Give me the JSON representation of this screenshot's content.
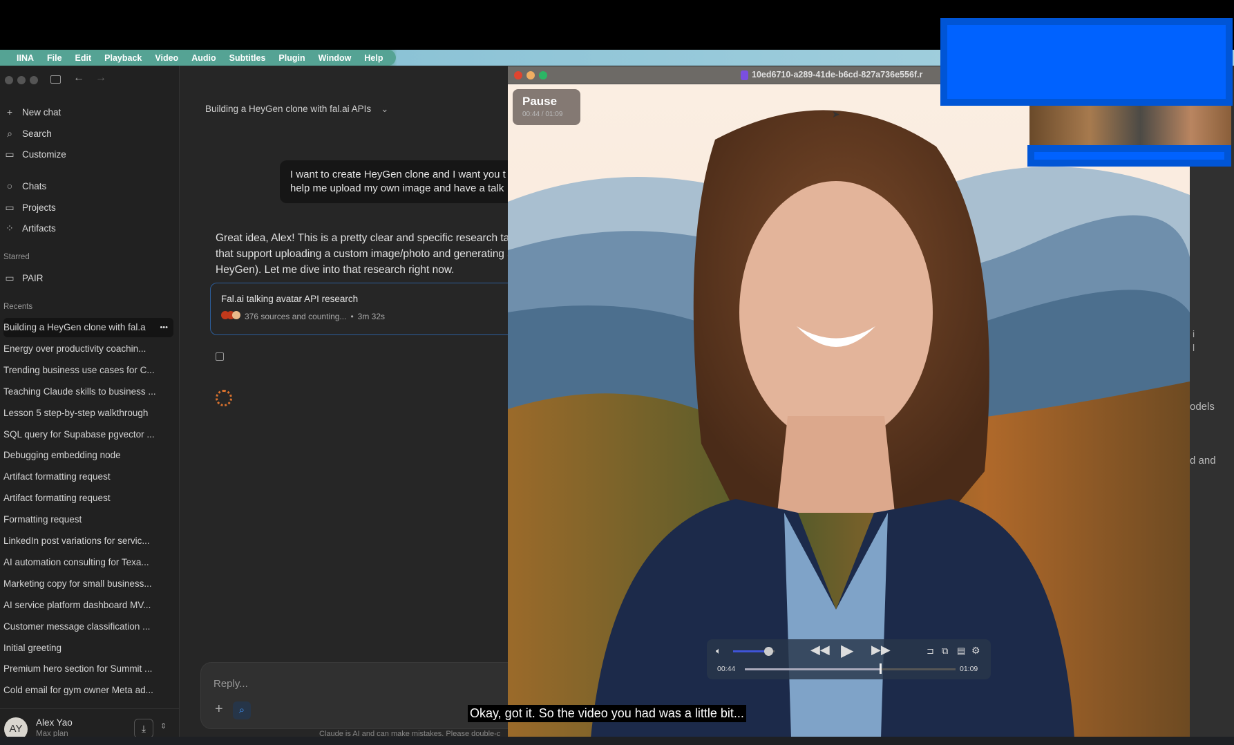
{
  "menubar": {
    "apple_icon": "apple-icon",
    "items": [
      "IINA",
      "File",
      "Edit",
      "Playback",
      "Video",
      "Audio",
      "Subtitles",
      "Plugin",
      "Window",
      "Help"
    ]
  },
  "sidebar": {
    "nav": [
      {
        "label": "New chat",
        "icon": "plus-icon"
      },
      {
        "label": "Search",
        "icon": "search-icon"
      },
      {
        "label": "Customize",
        "icon": "briefcase-icon"
      },
      {
        "label": "Chats",
        "icon": "chat-icon"
      },
      {
        "label": "Projects",
        "icon": "folder-icon"
      },
      {
        "label": "Artifacts",
        "icon": "artifacts-icon"
      }
    ],
    "starred_label": "Starred",
    "starred": [
      {
        "label": "PAIR"
      }
    ],
    "recents_label": "Recents",
    "recents": [
      "Building a HeyGen clone with fal.a",
      "Energy over productivity coachin...",
      "Trending business use cases for C...",
      "Teaching Claude skills to business ...",
      "Lesson 5 step-by-step walkthrough",
      "SQL query for Supabase pgvector ...",
      "Debugging embedding node",
      "Artifact formatting request",
      "Artifact formatting request",
      "Formatting request",
      "LinkedIn post variations for servic...",
      "AI automation consulting for Texa...",
      "Marketing copy for small business...",
      "AI service platform dashboard MV...",
      "Customer message classification ...",
      "Initial greeting",
      "Premium hero section for Summit ...",
      "Cold email for gym owner Meta ad..."
    ],
    "more_label": "•••",
    "user": {
      "initials": "AY",
      "name": "Alex Yao",
      "plan": "Max plan"
    }
  },
  "chat": {
    "title": "Building a HeyGen clone with fal.ai APIs",
    "user_message": [
      "I want to create HeyGen clone and I want you t",
      "help me upload my own image and have a talk"
    ],
    "assistant_message": [
      "Great idea, Alex! This is a pretty clear and specific research tas",
      "that support uploading a custom image/photo and generating a",
      "HeyGen). Let me dive into that research right now."
    ],
    "research_card": {
      "title": "Fal.ai talking avatar API research",
      "status": "376 sources and counting...",
      "separator": "•",
      "elapsed": "3m 32s"
    },
    "reply_placeholder": "Reply...",
    "disclaimer": "Claude is AI and can make mistakes. Please double-c"
  },
  "player": {
    "filename": "10ed6710-a289-41de-b6cd-827a736e556f.r",
    "osd_label": "Pause",
    "osd_time": "00:44 / 01:09",
    "current_time": "00:44",
    "duration": "01:09",
    "progress": 0.64,
    "volume": 0.85,
    "subtitle": "Okay, got it. So the video you had was a little bit..."
  },
  "background_text": [
    "i",
    "l",
    "odels",
    "d and"
  ],
  "colors": {
    "accent_blue": "#0062ff",
    "menubar": "#55a394",
    "card_border": "#2c5e9c"
  }
}
